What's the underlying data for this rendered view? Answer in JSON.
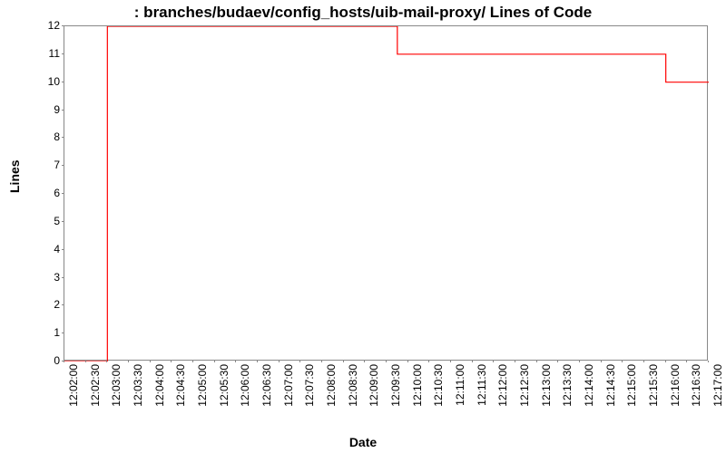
{
  "chart_data": {
    "type": "line",
    "title": ": branches/budaev/config_hosts/uib-mail-proxy/ Lines of Code",
    "xlabel": "Date",
    "ylabel": "Lines",
    "ylim": [
      0,
      12
    ],
    "x_ticks": [
      "12:02:00",
      "12:02:30",
      "12:03:00",
      "12:03:30",
      "12:04:00",
      "12:04:30",
      "12:05:00",
      "12:05:30",
      "12:06:00",
      "12:06:30",
      "12:07:00",
      "12:07:30",
      "12:08:00",
      "12:08:30",
      "12:09:00",
      "12:09:30",
      "12:10:00",
      "12:10:30",
      "12:11:00",
      "12:11:30",
      "12:12:00",
      "12:12:30",
      "12:13:00",
      "12:13:30",
      "12:14:00",
      "12:14:30",
      "12:15:00",
      "12:15:30",
      "12:16:00",
      "12:16:30",
      "12:17:00"
    ],
    "y_ticks": [
      0,
      1,
      2,
      3,
      4,
      5,
      6,
      7,
      8,
      9,
      10,
      11,
      12
    ],
    "series": [
      {
        "name": "Lines of Code",
        "color": "#ff0000",
        "points": [
          {
            "x": "12:02:00",
            "y": 0
          },
          {
            "x": "12:03:00",
            "y": 0
          },
          {
            "x": "12:03:00",
            "y": 12
          },
          {
            "x": "12:09:45",
            "y": 12
          },
          {
            "x": "12:09:45",
            "y": 11
          },
          {
            "x": "12:16:00",
            "y": 11
          },
          {
            "x": "12:16:00",
            "y": 10
          },
          {
            "x": "12:17:00",
            "y": 10
          }
        ]
      }
    ]
  }
}
